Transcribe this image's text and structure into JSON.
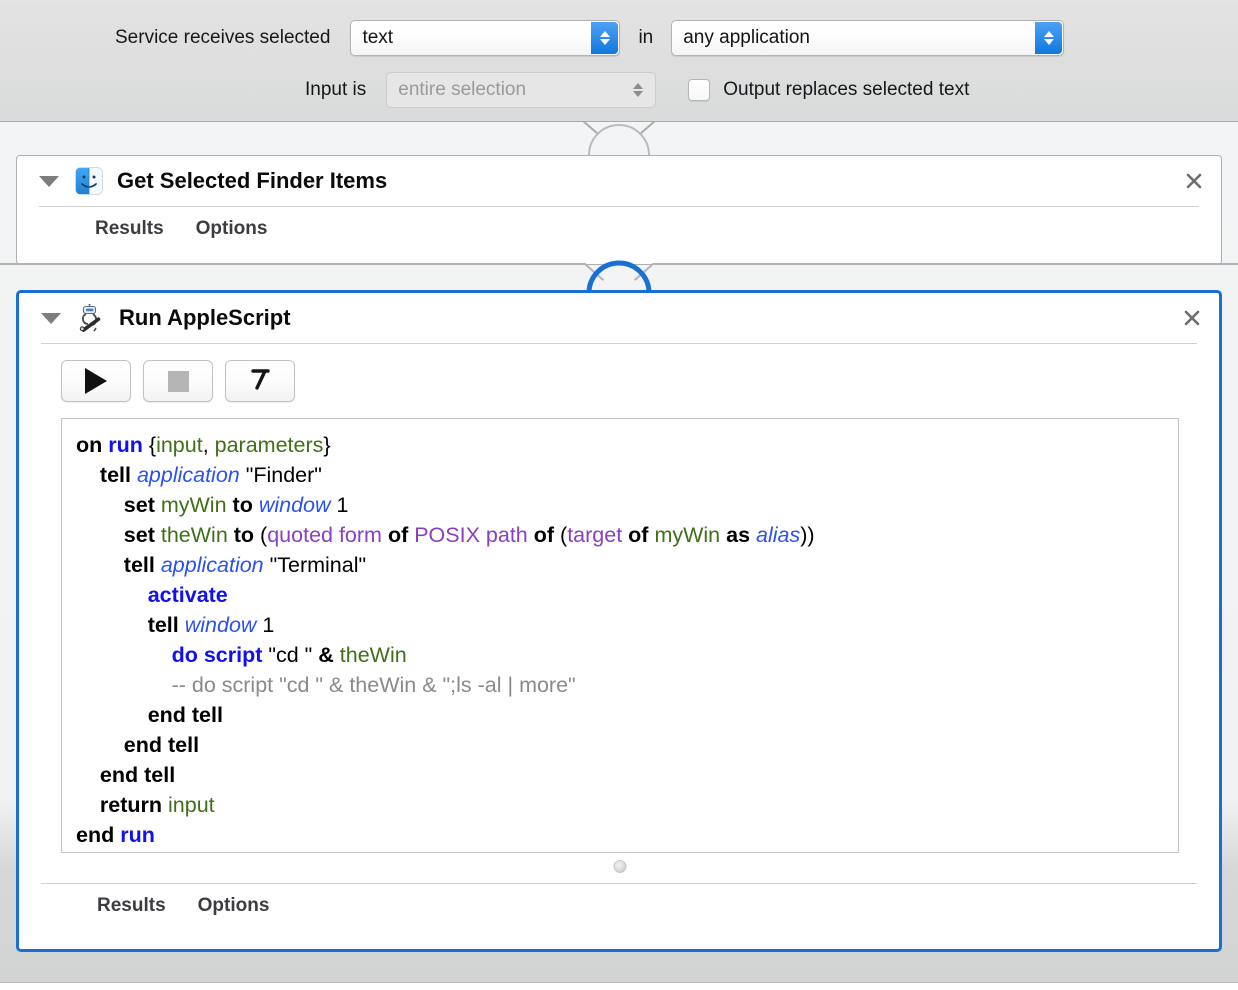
{
  "config_bar": {
    "receives_label": "Service receives selected",
    "receives_value": "text",
    "in_label": "in",
    "application_value": "any application",
    "input_is_label": "Input is",
    "input_is_value": "entire selection",
    "output_replaces_label": "Output replaces selected text",
    "output_replaces_checked": false,
    "accent_color": "#2f8de9"
  },
  "actions": [
    {
      "title": "Get Selected Finder Items",
      "icon": "finder-icon",
      "selected": false,
      "close_label": "×",
      "tabs": [
        {
          "label": "Results"
        },
        {
          "label": "Options"
        }
      ]
    },
    {
      "title": "Run AppleScript",
      "icon": "applescript-icon",
      "selected": true,
      "selection_color": "#1a6fd4",
      "close_label": "×",
      "toolbar": [
        {
          "name": "run-script-button",
          "icon": "play-icon",
          "enabled": true
        },
        {
          "name": "stop-script-button",
          "icon": "stop-icon",
          "enabled": false
        },
        {
          "name": "compile-script-button",
          "icon": "hammer-icon",
          "enabled": true
        }
      ],
      "tabs": [
        {
          "label": "Results"
        },
        {
          "label": "Options"
        }
      ],
      "script_lines": [
        [
          {
            "t": "on ",
            "c": "k"
          },
          {
            "t": "run",
            "c": "kb"
          },
          {
            "t": " ",
            "c": "str"
          },
          {
            "t": "{",
            "c": "str"
          },
          {
            "t": "input",
            "c": "var"
          },
          {
            "t": ", ",
            "c": "str"
          },
          {
            "t": "parameters",
            "c": "var"
          },
          {
            "t": "}",
            "c": "str"
          }
        ],
        [
          {
            "t": "    ",
            "c": "str"
          },
          {
            "t": "tell ",
            "c": "k"
          },
          {
            "t": "application",
            "c": "cls"
          },
          {
            "t": " \"Finder\"",
            "c": "str"
          }
        ],
        [
          {
            "t": "        ",
            "c": "str"
          },
          {
            "t": "set ",
            "c": "k"
          },
          {
            "t": "myWin",
            "c": "var"
          },
          {
            "t": " ",
            "c": "str"
          },
          {
            "t": "to ",
            "c": "k"
          },
          {
            "t": "window",
            "c": "cls"
          },
          {
            "t": " 1",
            "c": "num"
          }
        ],
        [
          {
            "t": "        ",
            "c": "str"
          },
          {
            "t": "set ",
            "c": "k"
          },
          {
            "t": "theWin",
            "c": "var"
          },
          {
            "t": " ",
            "c": "str"
          },
          {
            "t": "to ",
            "c": "k"
          },
          {
            "t": "(",
            "c": "str"
          },
          {
            "t": "quoted form",
            "c": "ref"
          },
          {
            "t": " ",
            "c": "str"
          },
          {
            "t": "of",
            "c": "k"
          },
          {
            "t": " ",
            "c": "str"
          },
          {
            "t": "POSIX path",
            "c": "ref"
          },
          {
            "t": " ",
            "c": "str"
          },
          {
            "t": "of",
            "c": "k"
          },
          {
            "t": " (",
            "c": "str"
          },
          {
            "t": "target",
            "c": "ref"
          },
          {
            "t": " ",
            "c": "str"
          },
          {
            "t": "of",
            "c": "k"
          },
          {
            "t": " ",
            "c": "str"
          },
          {
            "t": "myWin",
            "c": "var"
          },
          {
            "t": " ",
            "c": "str"
          },
          {
            "t": "as",
            "c": "k"
          },
          {
            "t": " ",
            "c": "str"
          },
          {
            "t": "alias",
            "c": "cls"
          },
          {
            "t": "))",
            "c": "str"
          }
        ],
        [
          {
            "t": "        ",
            "c": "str"
          },
          {
            "t": "tell ",
            "c": "k"
          },
          {
            "t": "application",
            "c": "cls"
          },
          {
            "t": " \"Terminal\"",
            "c": "str"
          }
        ],
        [
          {
            "t": "            ",
            "c": "str"
          },
          {
            "t": "activate",
            "c": "kb"
          }
        ],
        [
          {
            "t": "            ",
            "c": "str"
          },
          {
            "t": "tell ",
            "c": "k"
          },
          {
            "t": "window",
            "c": "cls"
          },
          {
            "t": " 1",
            "c": "num"
          }
        ],
        [
          {
            "t": "                ",
            "c": "str"
          },
          {
            "t": "do script",
            "c": "kb"
          },
          {
            "t": " \"cd \" ",
            "c": "str"
          },
          {
            "t": "&",
            "c": "k"
          },
          {
            "t": " ",
            "c": "str"
          },
          {
            "t": "theWin",
            "c": "var"
          }
        ],
        [
          {
            "t": "                ",
            "c": "str"
          },
          {
            "t": "-- do script \"cd \" & theWin & \";ls -al | more\"",
            "c": "cmt"
          }
        ],
        [
          {
            "t": "            ",
            "c": "str"
          },
          {
            "t": "end tell",
            "c": "k"
          }
        ],
        [
          {
            "t": "        ",
            "c": "str"
          },
          {
            "t": "end tell",
            "c": "k"
          }
        ],
        [
          {
            "t": "    ",
            "c": "str"
          },
          {
            "t": "end tell",
            "c": "k"
          }
        ],
        [
          {
            "t": "    ",
            "c": "str"
          },
          {
            "t": "return ",
            "c": "k"
          },
          {
            "t": "input",
            "c": "var"
          }
        ],
        [
          {
            "t": "end ",
            "c": "k"
          },
          {
            "t": "run",
            "c": "kb"
          }
        ]
      ]
    }
  ]
}
